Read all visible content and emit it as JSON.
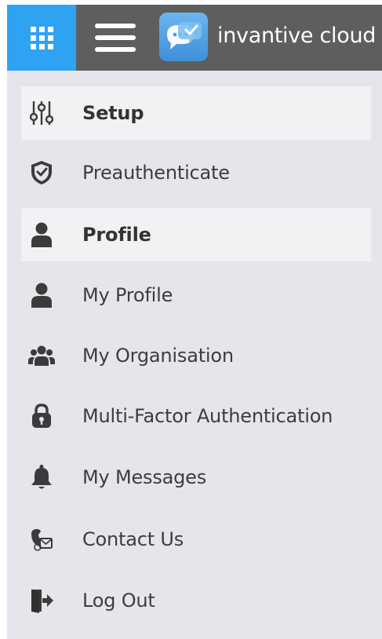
{
  "header": {
    "brand_text": "invantive cloud",
    "icons": [
      "apps-grid-icon",
      "hamburger-menu-icon",
      "invantive-logo-icon"
    ],
    "colors": {
      "topbar": "#5e5e5e",
      "apps_button": "#2ea3f2",
      "sidebar": "#e4e6eb",
      "section_bg": "#f1f2f4"
    }
  },
  "menu": {
    "items": [
      {
        "label": "Setup",
        "icon": "sliders-icon",
        "type": "section"
      },
      {
        "label": "Preauthenticate",
        "icon": "shield-check-icon",
        "type": "link"
      },
      {
        "label": "Profile",
        "icon": "user-icon",
        "type": "section"
      },
      {
        "label": "My Profile",
        "icon": "user-icon",
        "type": "link"
      },
      {
        "label": "My Organisation",
        "icon": "users-group-icon",
        "type": "link"
      },
      {
        "label": "Multi-Factor Authentication",
        "icon": "lock-icon",
        "type": "link"
      },
      {
        "label": "My Messages",
        "icon": "bell-icon",
        "type": "link"
      },
      {
        "label": "Contact Us",
        "icon": "contact-phone-icon",
        "type": "link"
      },
      {
        "label": "Log Out",
        "icon": "logout-icon",
        "type": "link"
      }
    ]
  }
}
